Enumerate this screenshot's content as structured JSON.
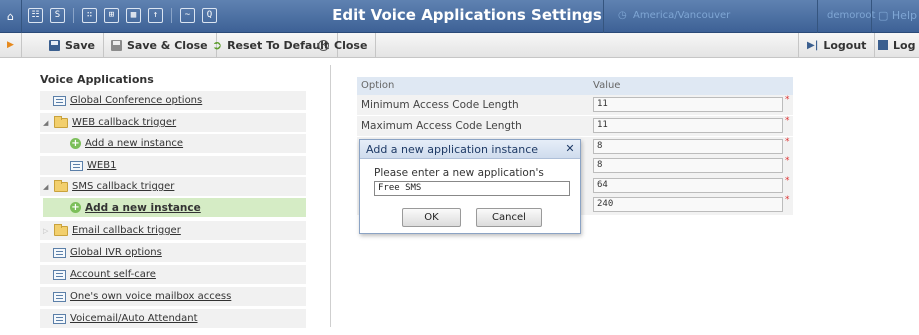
{
  "header": {
    "title": "Edit Voice Applications Settings",
    "timezone": "America/Vancouver",
    "user": "demoroot",
    "help": "Help",
    "nav_icons": [
      "☷",
      "S",
      "∷",
      "⊞",
      "▦",
      "↑",
      "~",
      "Q"
    ]
  },
  "toolbar": {
    "save": "Save",
    "save_close": "Save & Close",
    "reset": "Reset To Default",
    "close": "Close",
    "logout": "Logout",
    "log": "Log"
  },
  "tree": {
    "heading": "Voice Applications",
    "items": [
      {
        "label": "Global Conference options"
      },
      {
        "label": "WEB callback trigger"
      },
      {
        "label": "Add a new instance"
      },
      {
        "label": "WEB1"
      },
      {
        "label": "SMS callback trigger"
      },
      {
        "label": "Add a new instance"
      },
      {
        "label": "Email callback trigger"
      },
      {
        "label": "Global IVR options"
      },
      {
        "label": "Account self-care"
      },
      {
        "label": "One's own voice mailbox access"
      },
      {
        "label": "Voicemail/Auto Attendant"
      }
    ]
  },
  "options": {
    "col_option": "Option",
    "col_value": "Value",
    "rows": [
      {
        "name": "Minimum Access Code Length",
        "value": "11"
      },
      {
        "name": "Maximum Access Code Length",
        "value": "11"
      },
      {
        "name": "",
        "value": "8"
      },
      {
        "name": "",
        "value": "8"
      },
      {
        "name": "",
        "value": "64"
      },
      {
        "name": "",
        "value": "240"
      }
    ],
    "required_mark": "*"
  },
  "dialog": {
    "title": "Add a new application instance",
    "prompt": "Please enter a new application's name:",
    "input_value": "Free SMS",
    "ok": "OK",
    "cancel": "Cancel"
  },
  "colors": {
    "header_bg": "#4a6fa3",
    "selected_row": "#d5ecc5",
    "required": "#dd3333"
  }
}
